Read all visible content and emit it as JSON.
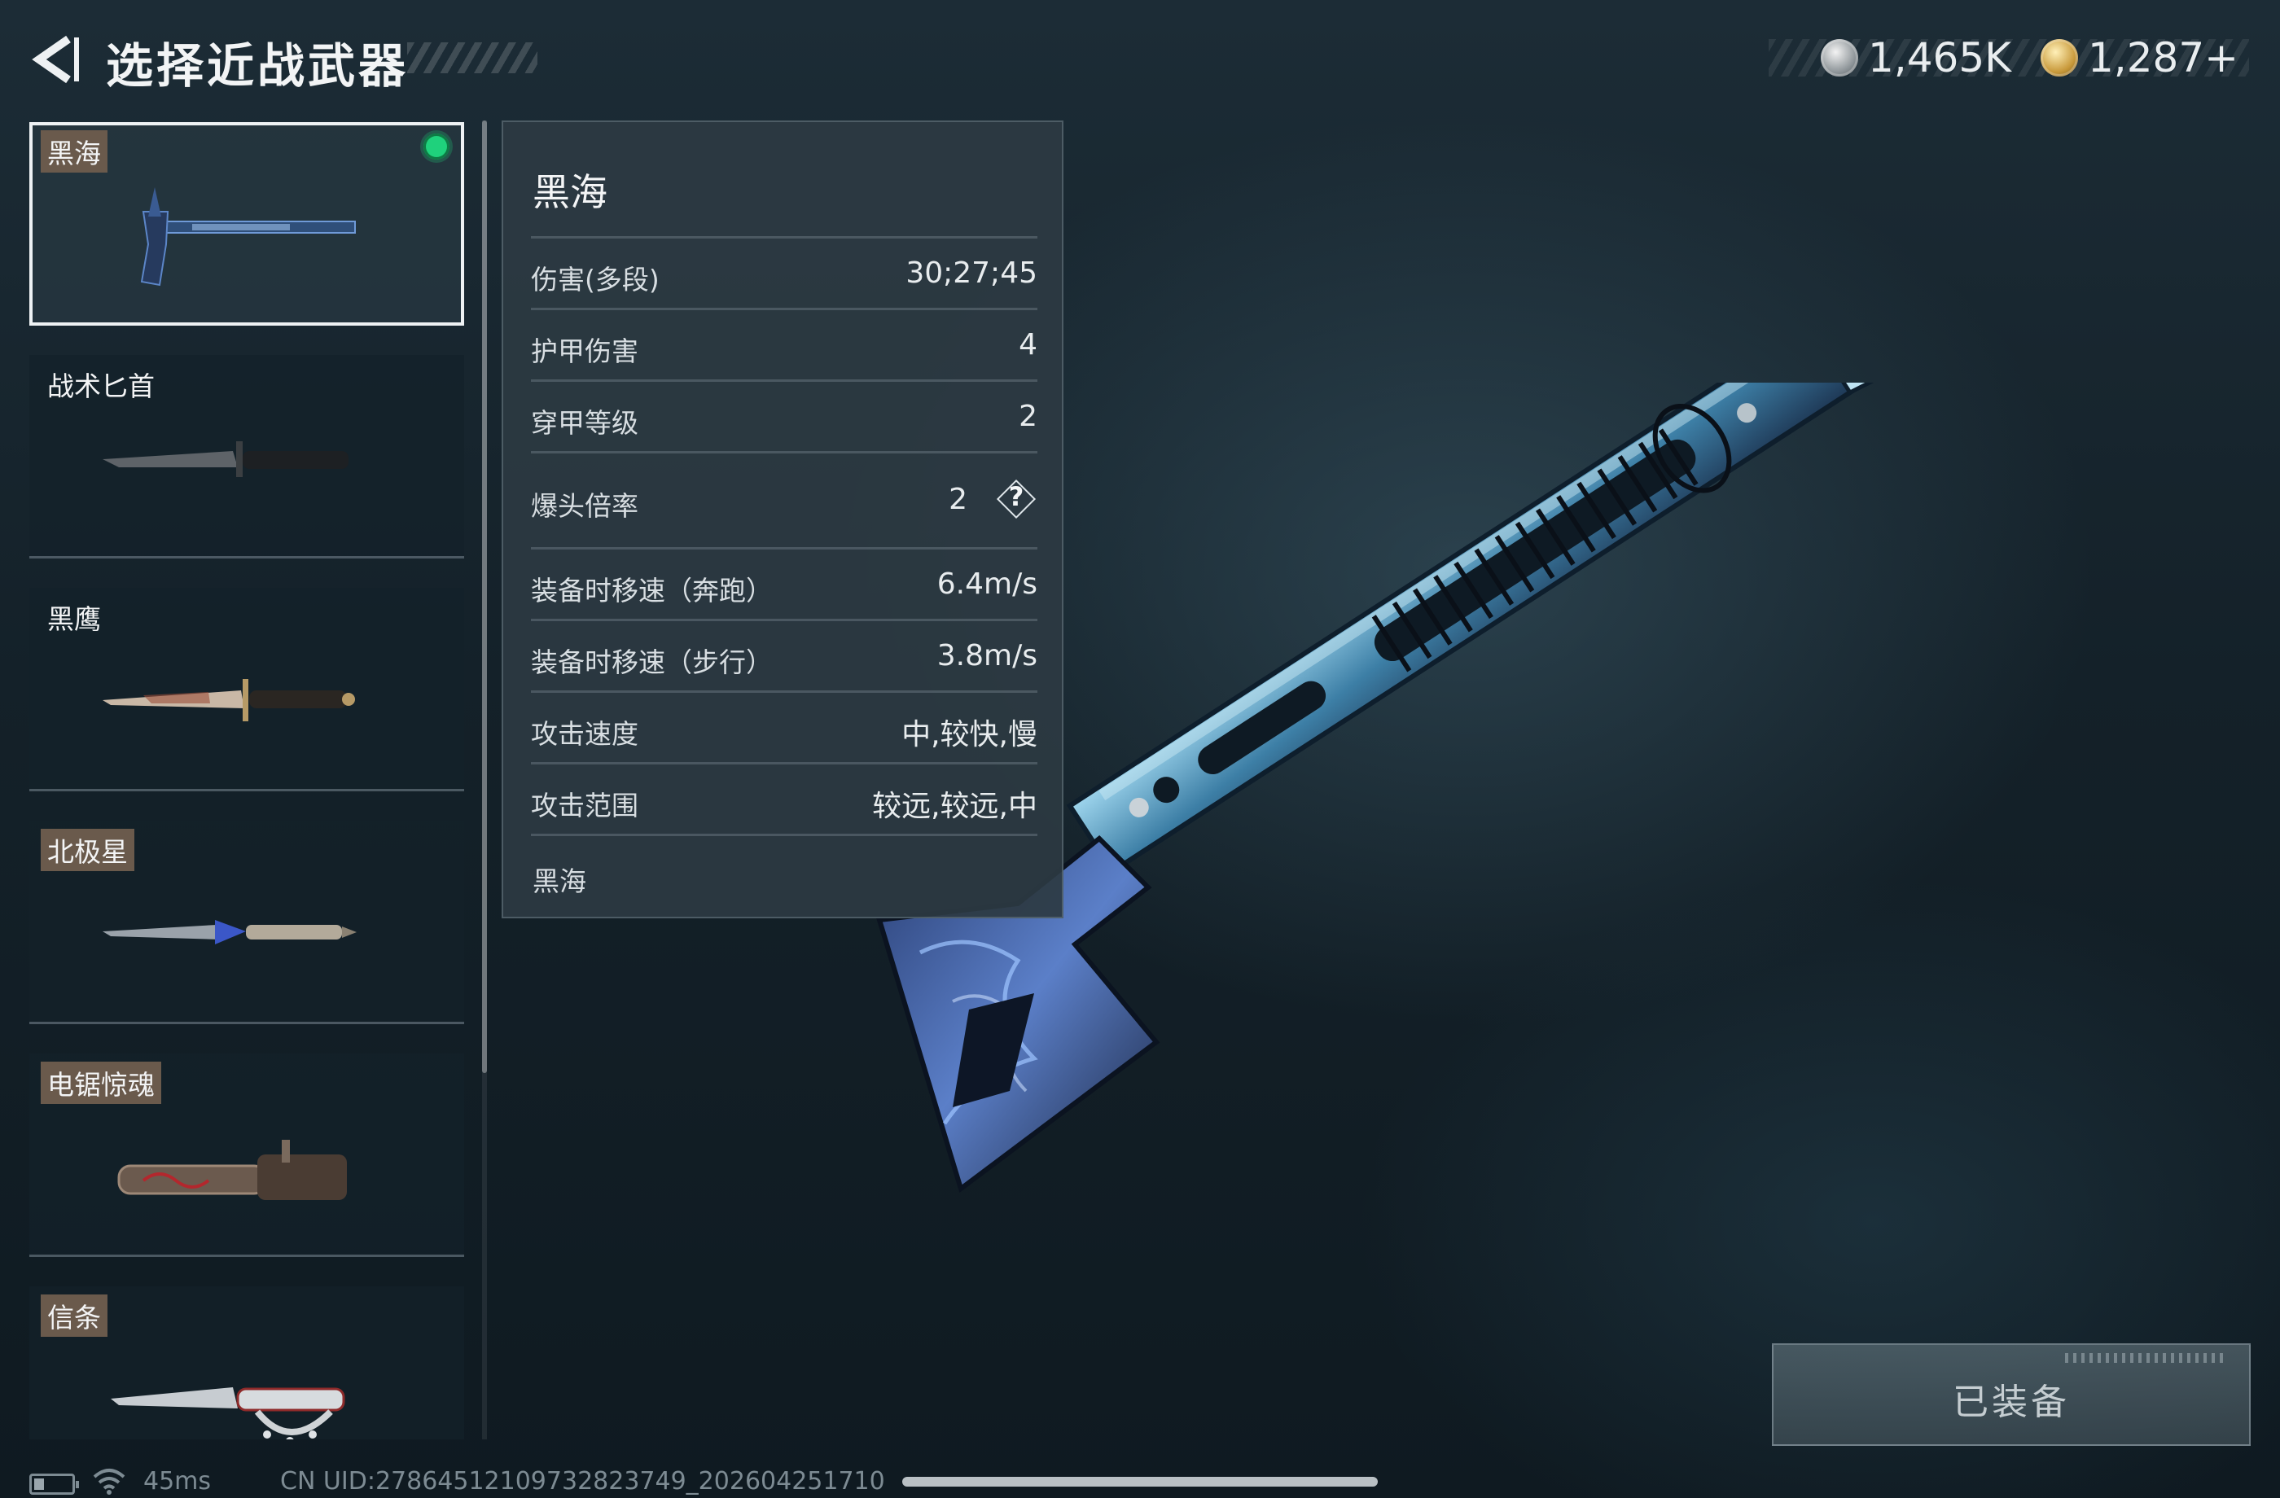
{
  "header": {
    "title": "选择近战武器",
    "currencies": [
      {
        "icon": "silver-coin-icon",
        "amount": "1,465K"
      },
      {
        "icon": "gold-coin-icon",
        "amount": "1,287+"
      }
    ]
  },
  "weapons": [
    {
      "name": "黑海",
      "tagged": true,
      "selected": true,
      "equipped": true
    },
    {
      "name": "战术匕首",
      "tagged": false,
      "selected": false,
      "equipped": false
    },
    {
      "name": "黑鹰",
      "tagged": false,
      "selected": false,
      "equipped": false
    },
    {
      "name": "北极星",
      "tagged": true,
      "selected": false,
      "equipped": false
    },
    {
      "name": "电锯惊魂",
      "tagged": true,
      "selected": false,
      "equipped": false
    },
    {
      "name": "信条",
      "tagged": true,
      "selected": false,
      "equipped": false
    }
  ],
  "stats": {
    "title": "黑海",
    "rows": [
      {
        "label": "伤害(多段)",
        "value": "30;27;45"
      },
      {
        "label": "护甲伤害",
        "value": "4"
      },
      {
        "label": "穿甲等级",
        "value": "2"
      },
      {
        "label": "爆头倍率",
        "value": "2",
        "help": "?"
      },
      {
        "label": "装备时移速（奔跑）",
        "value": "6.4m/s"
      },
      {
        "label": "装备时移速（步行）",
        "value": "3.8m/s"
      },
      {
        "label": "攻击速度",
        "value": "中,较快,慢"
      },
      {
        "label": "攻击范围",
        "value": "较远,较远,中"
      }
    ],
    "footer": "黑海"
  },
  "equip_button": {
    "label": "已装备"
  },
  "status_bar": {
    "ping": "45ms",
    "uid": "CN UID:278645121097328237​49_20260425171​0"
  },
  "colors": {
    "background": "#142129",
    "panel": "#2c3942",
    "equipped_indicator": "#1fd17c",
    "label_tag": "#6a5a4c",
    "weapon_blue": "#3b6fd6"
  }
}
